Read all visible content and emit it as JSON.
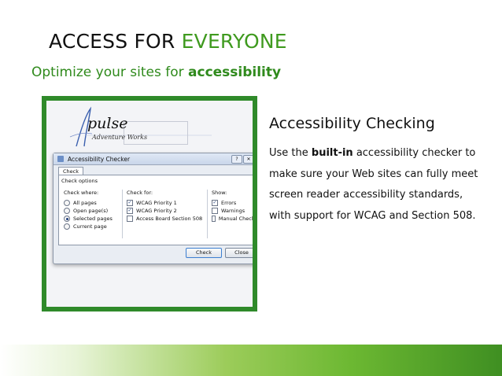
{
  "slide": {
    "title_prefix": "ACCESS FOR ",
    "title_accent": "EVERYONE",
    "subtitle_prefix": "Optimize your sites for ",
    "subtitle_bold": "accessibility",
    "heading": "Accessibility Checking",
    "body_prefix": "Use the ",
    "body_bold": "built-in",
    "body_rest": " accessibility checker to make sure your Web sites can fully meet screen reader accessibility standards, with support for WCAG and Section 508."
  },
  "screenshot": {
    "logo_word": "pulse",
    "logo_tagline": "Adventure Works",
    "dialog": {
      "title": "Accessibility Checker",
      "tab": "Check",
      "group_label": "Check options",
      "check_where": {
        "label": "Check where:",
        "options": [
          {
            "label": "All pages",
            "selected": false
          },
          {
            "label": "Open page(s)",
            "selected": false
          },
          {
            "label": "Selected pages",
            "selected": true
          },
          {
            "label": "Current page",
            "selected": false
          }
        ]
      },
      "check_for": {
        "label": "Check for:",
        "options": [
          {
            "label": "WCAG Priority 1",
            "checked": true
          },
          {
            "label": "WCAG Priority 2",
            "checked": true
          },
          {
            "label": "Access Board Section 508",
            "checked": false
          }
        ]
      },
      "show": {
        "label": "Show:",
        "options": [
          {
            "label": "Errors",
            "checked": true
          },
          {
            "label": "Warnings",
            "checked": false
          },
          {
            "label": "Manual Checks",
            "checked": false
          }
        ]
      },
      "check_button": "Check",
      "close_button": "Close"
    }
  },
  "colors": {
    "accent_green": "#3f9a1f",
    "frame_green": "#2f8a2a"
  }
}
